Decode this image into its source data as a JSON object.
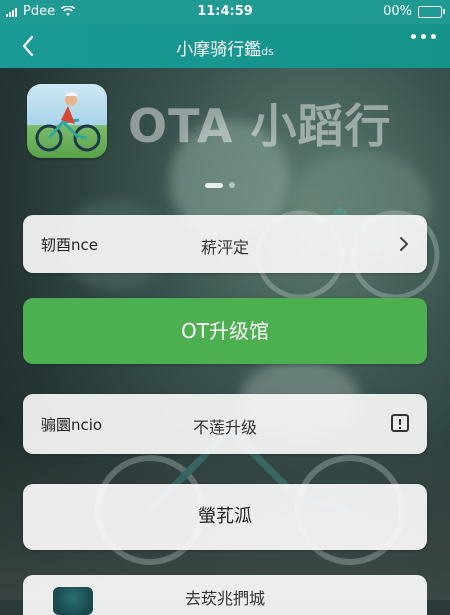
{
  "status_bar": {
    "carrier": "Pdee",
    "time": "11:4:59",
    "battery": "00%"
  },
  "nav": {
    "title": "小摩骑行鑑",
    "title_suffix": "ds"
  },
  "banner": {
    "title": "OTA 小蹈行",
    "page_count": 2,
    "active_page": 1
  },
  "rows": {
    "row1": {
      "label": "轫酉nce",
      "value": "菥泙定"
    },
    "row2": {
      "label": "骟圜ncio",
      "value": "不莲升级"
    }
  },
  "buttons": {
    "ota_upgrade": "OT升级馆",
    "secondary": "螢芤泒"
  },
  "bottom_card": {
    "text": "去莰兆捫城"
  },
  "colors": {
    "header": "#1a9a96",
    "primary_button": "#4caf50"
  }
}
